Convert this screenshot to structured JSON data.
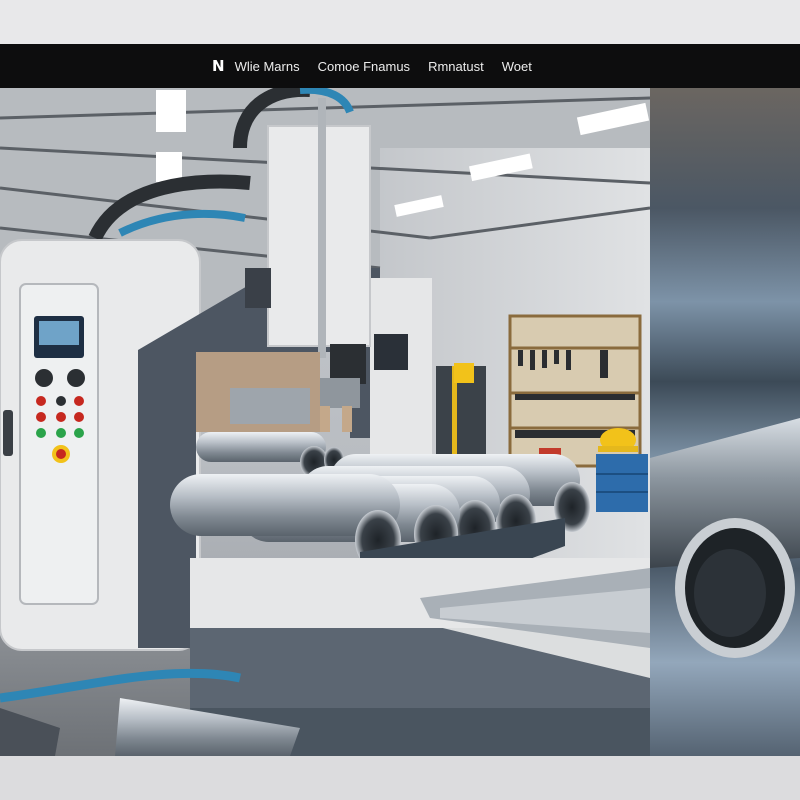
{
  "nav": {
    "logo": "N",
    "links": [
      "Wlie Marns",
      "Comoe Fnamus",
      "Rmnatust",
      "Woet"
    ]
  },
  "colors": {
    "navbar": "#0d0d0e",
    "machine_body": "#e9eaeb",
    "frame": "#4d5662",
    "hose": "#2e86b5",
    "tube": "#b8bec6",
    "helmet": "#f2c21a"
  },
  "icons": [
    "logo-icon",
    "control-panel-screen-icon",
    "emergency-stop-icon"
  ]
}
